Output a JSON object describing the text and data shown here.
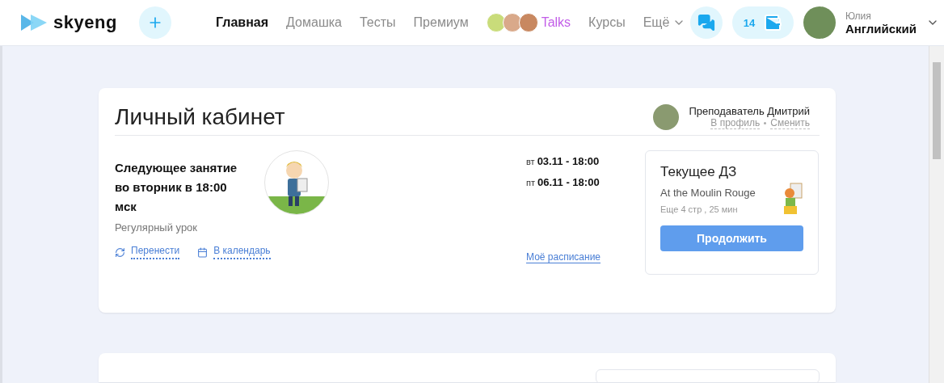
{
  "header": {
    "logo": "skyeng",
    "nav": [
      {
        "label": "Главная",
        "selected": true,
        "kind": "link"
      },
      {
        "label": "Домашка",
        "selected": false,
        "kind": "link"
      },
      {
        "label": "Тесты",
        "selected": false,
        "kind": "link"
      },
      {
        "label": "Премиум",
        "selected": false,
        "kind": "link"
      },
      {
        "label": "Talks",
        "selected": false,
        "kind": "talks"
      },
      {
        "label": "Курсы",
        "selected": false,
        "kind": "link"
      },
      {
        "label": "Ещё",
        "selected": false,
        "kind": "dropdown"
      }
    ],
    "wallet_count": "14",
    "user": {
      "name": "Юлия",
      "course": "Английский"
    }
  },
  "dashboard": {
    "title": "Личный кабинет",
    "teacher": {
      "name": "Преподаватель Дмитрий",
      "links": [
        "В профиль",
        "Сменить"
      ]
    },
    "next_lesson": {
      "title": "Следующее занятие во вторник в 18:00 мск",
      "subtitle": "Регулярный урок",
      "actions": [
        {
          "label": "Перенести",
          "kind": "reschedule"
        },
        {
          "label": "В календарь",
          "kind": "calendar"
        }
      ]
    },
    "schedule": [
      {
        "day": "вт",
        "time": "03.11 - 18:00"
      },
      {
        "day": "пт",
        "time": "06.11 - 18:00"
      }
    ],
    "schedule_link": "Моё расписание",
    "homework": {
      "title": "Текущее ДЗ",
      "lesson": "At the Moulin Rouge",
      "remaining": "Еще 4 стр , 25 мин",
      "button": "Продолжить"
    }
  }
}
